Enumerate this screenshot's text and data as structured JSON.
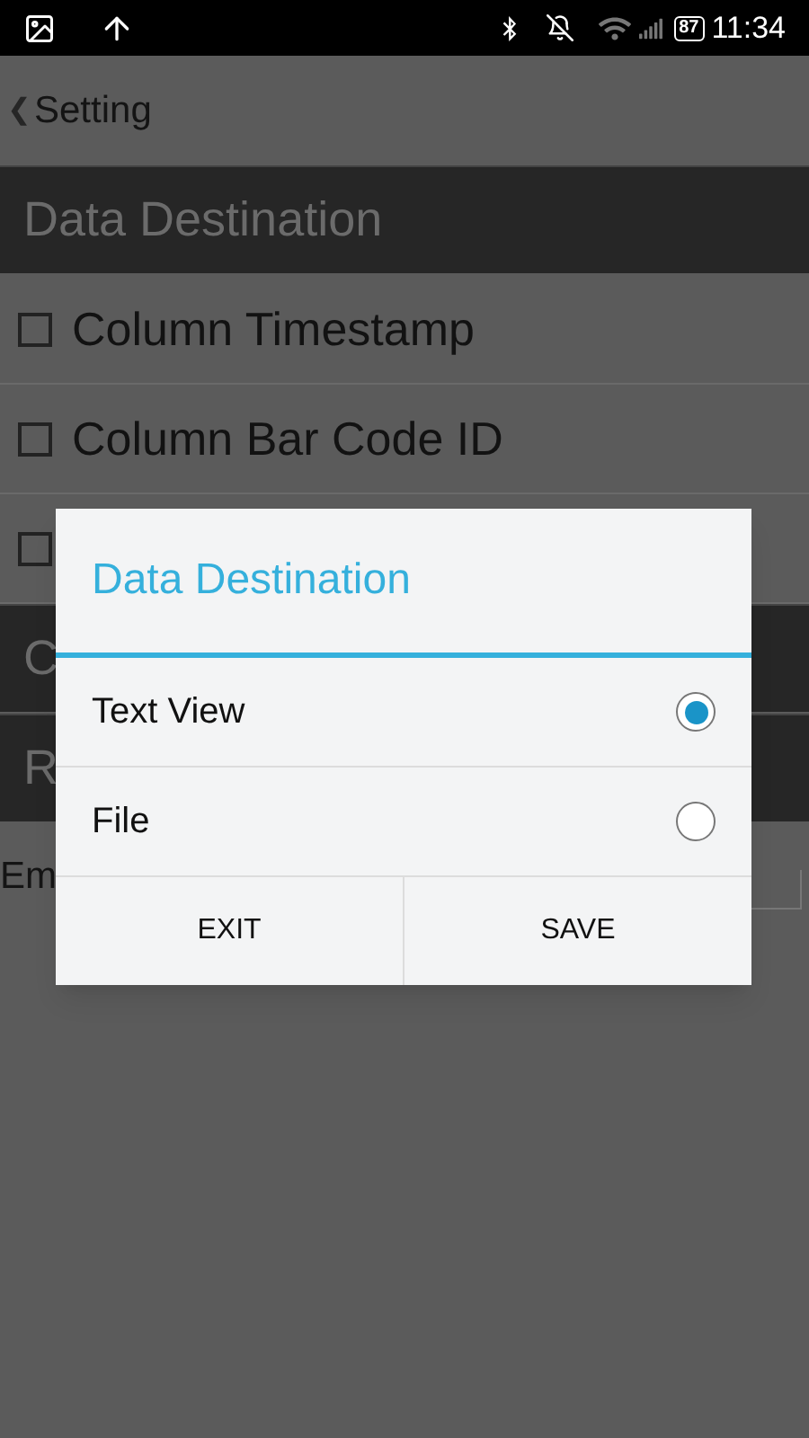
{
  "status_bar": {
    "battery": "87",
    "time": "11:34"
  },
  "header": {
    "back_icon": "❮",
    "title": "Setting"
  },
  "sections": [
    {
      "kind": "header",
      "label": "Data Destination"
    },
    {
      "kind": "checkbox",
      "label": "Column Timestamp",
      "checked": false
    },
    {
      "kind": "checkbox",
      "label": "Column Bar Code ID",
      "checked": false
    },
    {
      "kind": "checkbox",
      "checked": false
    },
    {
      "kind": "header",
      "label": "C"
    },
    {
      "kind": "header",
      "label": "R"
    },
    {
      "kind": "field",
      "label": "Em"
    }
  ],
  "dialog": {
    "title": "Data Destination",
    "options": [
      {
        "label": "Text View",
        "selected": true
      },
      {
        "label": "File",
        "selected": false
      }
    ],
    "buttons": [
      "EXIT",
      "SAVE"
    ]
  }
}
